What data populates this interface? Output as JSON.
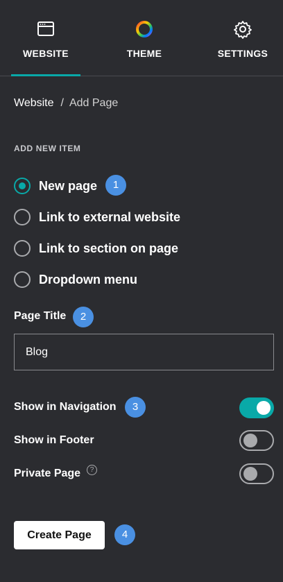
{
  "tabs": [
    {
      "label": "WEBSITE",
      "icon": "browser-window-icon",
      "active": true
    },
    {
      "label": "THEME",
      "icon": "color-ring-icon",
      "active": false
    },
    {
      "label": "SETTINGS",
      "icon": "gear-icon",
      "active": false
    }
  ],
  "breadcrumb": {
    "parent": "Website",
    "separator": "/",
    "current": "Add Page"
  },
  "section_label": "ADD NEW ITEM",
  "options": [
    {
      "label": "New page",
      "selected": true,
      "badge": "1"
    },
    {
      "label": "Link to external website",
      "selected": false
    },
    {
      "label": "Link to section on page",
      "selected": false
    },
    {
      "label": "Dropdown menu",
      "selected": false
    }
  ],
  "page_title": {
    "label": "Page Title",
    "badge": "2",
    "value": "Blog"
  },
  "toggles": [
    {
      "label": "Show in Navigation",
      "on": true,
      "badge": "3"
    },
    {
      "label": "Show in Footer",
      "on": false
    },
    {
      "label": "Private Page",
      "on": false,
      "help": "?"
    }
  ],
  "create_button": {
    "label": "Create Page",
    "badge": "4"
  },
  "colors": {
    "background": "#2b2c30",
    "accent": "#09a9a8",
    "badge": "#4a90e2",
    "divider": "#4a4b50"
  }
}
